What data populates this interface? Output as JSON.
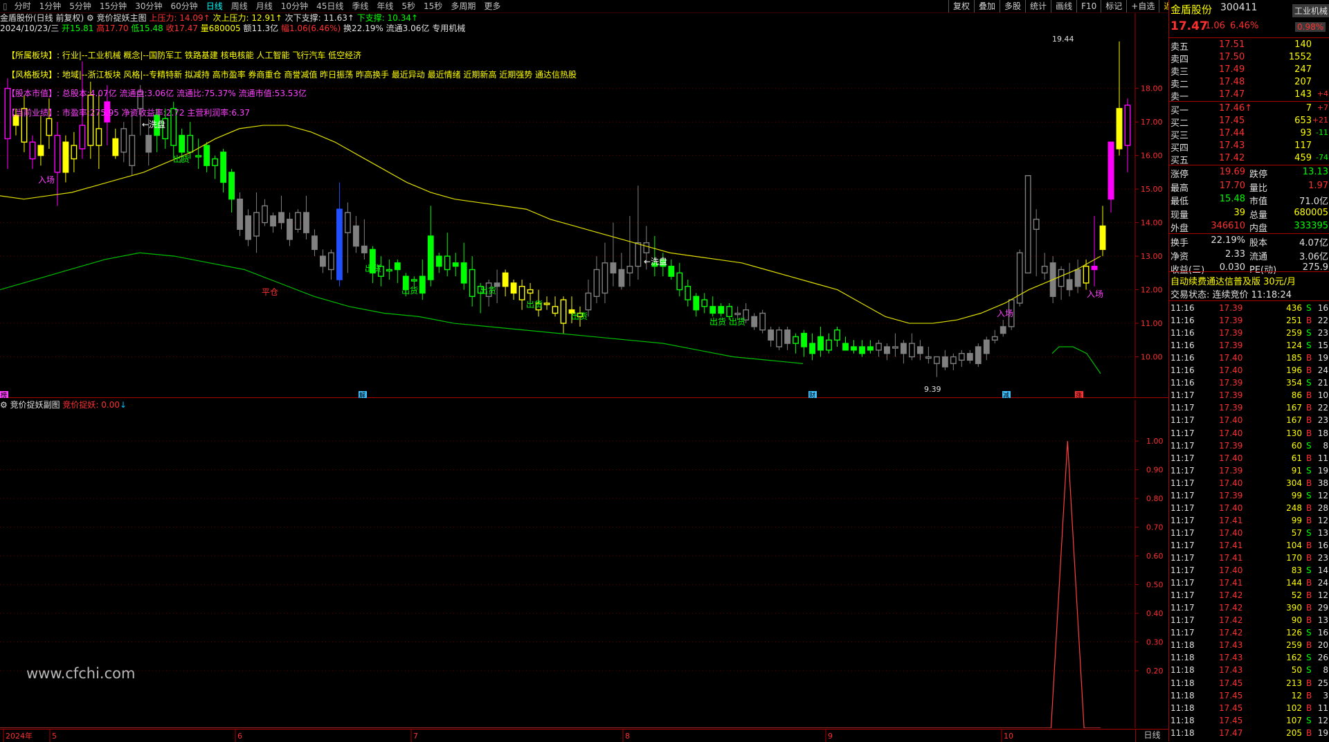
{
  "toolbar": {
    "tabs": [
      "分时",
      "1分钟",
      "5分钟",
      "15分钟",
      "30分钟",
      "60分钟",
      "日线",
      "周线",
      "月线",
      "10分钟",
      "45日线",
      "季线",
      "年线",
      "5秒",
      "15秒",
      "多周期",
      "更多"
    ],
    "active_tab": "日线",
    "right_buttons": [
      "复权",
      "叠加",
      "多股",
      "统计",
      "画线",
      "F10",
      "标记",
      "+自选",
      "返回"
    ]
  },
  "header": {
    "stock_label": "金盾股份(日线 前复权)",
    "indicator_name": "竞价捉妖主图",
    "resist": "上压力: 14.09",
    "resist2": "次上压力: 12.91",
    "support2": "次下支撑: 11.63",
    "support": "下支撑: 10.34",
    "date": "2024/10/23/三",
    "open": "开15.81",
    "high": "高17.70",
    "low": "低15.48",
    "close": "收17.47",
    "volume": "量680005",
    "amount": "额11.3亿",
    "change": "幅1.06(6.46%)",
    "turnover": "换22.19%",
    "float": "流通3.06亿",
    "sector": "专用机械"
  },
  "info": {
    "sector_label": "【所属板块】:",
    "sector_text": "行业|--工业机械  概念|--国防军工  铁路基建  核电核能  人工智能  飞行汽车  低空经济",
    "style_label": "【风格板块】:",
    "style_text": "地域|--浙江板块  风格|--专精特新  拟减持  高市盈率  券商重仓  商誉减值  昨日振荡  昨高换手  最近异动  最近情绪  近期新高  近期强势  通达信热股",
    "cap_label": "【股本市值】:",
    "cap_text": "总股本:4.07亿  流通盘:3.06亿  流通比:75.37%  流通市值:53.53亿",
    "perf_label": "【当前业绩】:",
    "perf_text": "市盈率:275.95  净资收益率:2.72  主营利润率:6.37"
  },
  "chart_labels": {
    "xipan1": "←洗盘",
    "xipan2": "←洗盘",
    "ruchang": "入场",
    "chuhuo": "出货",
    "pingcang": "平仓",
    "max_label": "19.44",
    "min_label": "9.39"
  },
  "price_axis": [
    "18.00",
    "17.00",
    "16.00",
    "15.00",
    "14.00",
    "13.00",
    "12.00",
    "11.00",
    "10.00"
  ],
  "bottom_badges": [
    "榜",
    "解",
    "财",
    "减",
    "涨"
  ],
  "sub": {
    "title": "竞价捉妖副图",
    "value_label": "竞价捉妖: 0.00",
    "axis": [
      "1.00",
      "0.90",
      "0.80",
      "0.70",
      "0.60",
      "0.50",
      "0.40",
      "0.30",
      "0.20"
    ],
    "watermark": "www.cfchi.com"
  },
  "time_axis": {
    "labels": [
      "2024年",
      "5",
      "6",
      "7",
      "8",
      "9",
      "10"
    ],
    "period": "日线"
  },
  "quote": {
    "name": "金盾股份",
    "code": "300411",
    "industry_tag": "工业机械",
    "price": "17.47",
    "change": "1.06",
    "pct": "6.46%",
    "ratio": "0.98%",
    "asks": [
      {
        "label": "卖五",
        "price": "17.51",
        "vol": "140",
        "chg": ""
      },
      {
        "label": "卖四",
        "price": "17.50",
        "vol": "1552",
        "chg": ""
      },
      {
        "label": "卖三",
        "price": "17.49",
        "vol": "247",
        "chg": ""
      },
      {
        "label": "卖二",
        "price": "17.48",
        "vol": "207",
        "chg": ""
      },
      {
        "label": "卖一",
        "price": "17.47",
        "vol": "143",
        "chg": "+4"
      }
    ],
    "bids": [
      {
        "label": "买一",
        "price": "17.46↑",
        "vol": "7",
        "chg": "+7"
      },
      {
        "label": "买二",
        "price": "17.45",
        "vol": "653",
        "chg": "+21"
      },
      {
        "label": "买三",
        "price": "17.44",
        "vol": "93",
        "chg": "-11"
      },
      {
        "label": "买四",
        "price": "17.43",
        "vol": "117",
        "chg": ""
      },
      {
        "label": "买五",
        "price": "17.42",
        "vol": "459",
        "chg": "-74"
      }
    ],
    "stats": [
      {
        "l1": "涨停",
        "v1": "19.69",
        "l2": "跌停",
        "v2": "13.13"
      },
      {
        "l1": "最高",
        "v1": "17.70",
        "l2": "量比",
        "v2": "1.97"
      },
      {
        "l1": "最低",
        "v1": "15.48",
        "l2": "市值",
        "v2": "71.0亿"
      },
      {
        "l1": "现量",
        "v1": "39",
        "l2": "总量",
        "v2": "680005"
      },
      {
        "l1": "外盘",
        "v1": "346610",
        "l2": "内盘",
        "v2": "333395"
      }
    ],
    "stats2": [
      {
        "l1": "换手",
        "v1": "22.19%",
        "l2": "股本",
        "v2": "4.07亿"
      },
      {
        "l1": "净资",
        "v1": "2.33",
        "l2": "流通",
        "v2": "3.06亿"
      },
      {
        "l1": "收益(三)",
        "v1": "0.030",
        "l2": "PE(动)",
        "v2": "275.9"
      }
    ],
    "promo": "自动续费通达信普及版 30元/月",
    "status": "交易状态: 连续竞价 11:18:24"
  },
  "ticks": [
    {
      "t": "11:16",
      "p": "17.39",
      "v": "436",
      "s": "S",
      "n": "16"
    },
    {
      "t": "11:16",
      "p": "17.39",
      "v": "251",
      "s": "B",
      "n": "22"
    },
    {
      "t": "11:16",
      "p": "17.39",
      "v": "259",
      "s": "S",
      "n": "23"
    },
    {
      "t": "11:16",
      "p": "17.39",
      "v": "124",
      "s": "S",
      "n": "15"
    },
    {
      "t": "11:16",
      "p": "17.40",
      "v": "185",
      "s": "B",
      "n": "19"
    },
    {
      "t": "11:16",
      "p": "17.40",
      "v": "196",
      "s": "B",
      "n": "24"
    },
    {
      "t": "11:16",
      "p": "17.39",
      "v": "354",
      "s": "S",
      "n": "21"
    },
    {
      "t": "11:17",
      "p": "17.39",
      "v": "86",
      "s": "B",
      "n": "10"
    },
    {
      "t": "11:17",
      "p": "17.39",
      "v": "167",
      "s": "B",
      "n": "22"
    },
    {
      "t": "11:17",
      "p": "17.40",
      "v": "167",
      "s": "B",
      "n": "23"
    },
    {
      "t": "11:17",
      "p": "17.40",
      "v": "130",
      "s": "B",
      "n": "18"
    },
    {
      "t": "11:17",
      "p": "17.39",
      "v": "60",
      "s": "S",
      "n": "8"
    },
    {
      "t": "11:17",
      "p": "17.40",
      "v": "61",
      "s": "B",
      "n": "11"
    },
    {
      "t": "11:17",
      "p": "17.39",
      "v": "91",
      "s": "S",
      "n": "19"
    },
    {
      "t": "11:17",
      "p": "17.40",
      "v": "304",
      "s": "B",
      "n": "38"
    },
    {
      "t": "11:17",
      "p": "17.39",
      "v": "99",
      "s": "S",
      "n": "12"
    },
    {
      "t": "11:17",
      "p": "17.40",
      "v": "248",
      "s": "B",
      "n": "28"
    },
    {
      "t": "11:17",
      "p": "17.41",
      "v": "99",
      "s": "B",
      "n": "12"
    },
    {
      "t": "11:17",
      "p": "17.40",
      "v": "57",
      "s": "S",
      "n": "13"
    },
    {
      "t": "11:17",
      "p": "17.41",
      "v": "104",
      "s": "B",
      "n": "16"
    },
    {
      "t": "11:17",
      "p": "17.41",
      "v": "170",
      "s": "B",
      "n": "23"
    },
    {
      "t": "11:17",
      "p": "17.40",
      "v": "83",
      "s": "S",
      "n": "14"
    },
    {
      "t": "11:17",
      "p": "17.41",
      "v": "144",
      "s": "B",
      "n": "24"
    },
    {
      "t": "11:17",
      "p": "17.42",
      "v": "52",
      "s": "B",
      "n": "12"
    },
    {
      "t": "11:17",
      "p": "17.42",
      "v": "390",
      "s": "B",
      "n": "29"
    },
    {
      "t": "11:17",
      "p": "17.42",
      "v": "90",
      "s": "B",
      "n": "13"
    },
    {
      "t": "11:17",
      "p": "17.42",
      "v": "126",
      "s": "S",
      "n": "16"
    },
    {
      "t": "11:18",
      "p": "17.43",
      "v": "259",
      "s": "B",
      "n": "20"
    },
    {
      "t": "11:18",
      "p": "17.43",
      "v": "162",
      "s": "S",
      "n": "26"
    },
    {
      "t": "11:18",
      "p": "17.43",
      "v": "50",
      "s": "S",
      "n": "8"
    },
    {
      "t": "11:18",
      "p": "17.45",
      "v": "213",
      "s": "B",
      "n": "25"
    },
    {
      "t": "11:18",
      "p": "17.45",
      "v": "12",
      "s": "B",
      "n": "3"
    },
    {
      "t": "11:18",
      "p": "17.45",
      "v": "102",
      "s": "B",
      "n": "11"
    },
    {
      "t": "11:18",
      "p": "17.45",
      "v": "107",
      "s": "S",
      "n": "12"
    },
    {
      "t": "11:18",
      "p": "17.47",
      "v": "205",
      "s": "B",
      "n": "19"
    }
  ],
  "chart_data": {
    "type": "candlestick",
    "dates": [
      "5月",
      "6月",
      "7月",
      "8月",
      "9月",
      "10月"
    ],
    "candles": [
      [
        16.5,
        18.0,
        15.6,
        18.3
      ],
      [
        17.2,
        16.9,
        16.6,
        17.4
      ],
      [
        16.4,
        17.4,
        16.1,
        17.8
      ],
      [
        15.9,
        16.4,
        15.6,
        16.6
      ],
      [
        16.3,
        16.0,
        15.7,
        17.2
      ],
      [
        16.6,
        17.1,
        16.2,
        17.7
      ],
      [
        15.5,
        16.6,
        14.5,
        17.0
      ],
      [
        16.4,
        15.5,
        15.2,
        16.6
      ],
      [
        15.9,
        16.3,
        15.5,
        16.7
      ],
      [
        16.2,
        16.9,
        15.9,
        18.8
      ],
      [
        16.3,
        17.8,
        15.9,
        18.2
      ],
      [
        16.3,
        16.8,
        15.6,
        17.8
      ],
      [
        17.6,
        17.0,
        16.3,
        18.1
      ],
      [
        16.5,
        16.0,
        15.9,
        16.8
      ],
      [
        16.1,
        16.8,
        15.8,
        17.0
      ],
      [
        15.7,
        16.6,
        15.4,
        17.3
      ],
      [
        17.4,
        17.9,
        16.6,
        18.1
      ],
      [
        16.6,
        16.1,
        15.7,
        17.1
      ],
      [
        17.2,
        16.6,
        16.1,
        17.4
      ],
      [
        16.5,
        17.1,
        16.2,
        17.4
      ],
      [
        16.3,
        17.4,
        15.9,
        17.6
      ],
      [
        16.6,
        16.1,
        15.8,
        16.8
      ],
      [
        16.1,
        16.6,
        15.9,
        17.0
      ],
      [
        16.0,
        16.0,
        15.6,
        16.5
      ],
      [
        16.3,
        15.7,
        15.5,
        16.4
      ],
      [
        15.7,
        15.9,
        15.3,
        16.0
      ],
      [
        16.1,
        15.2,
        14.9,
        16.2
      ],
      [
        15.5,
        14.7,
        14.3,
        15.6
      ],
      [
        14.7,
        13.8,
        13.6,
        14.9
      ],
      [
        14.2,
        13.5,
        13.3,
        14.4
      ],
      [
        13.6,
        14.3,
        13.1,
        14.9
      ],
      [
        14.0,
        14.5,
        13.9,
        14.7
      ],
      [
        14.2,
        13.9,
        13.7,
        14.3
      ],
      [
        14.3,
        14.0,
        13.8,
        14.8
      ],
      [
        14.1,
        13.5,
        13.3,
        14.3
      ],
      [
        13.8,
        14.3,
        13.7,
        14.4
      ],
      [
        14.3,
        13.7,
        13.5,
        14.8
      ],
      [
        13.6,
        13.2,
        13.0,
        13.8
      ],
      [
        13.0,
        12.7,
        12.5,
        13.2
      ],
      [
        12.6,
        13.1,
        12.3,
        13.2
      ],
      [
        14.4,
        12.3,
        12.1,
        15.2
      ],
      [
        13.7,
        14.3,
        12.5,
        14.6
      ],
      [
        13.9,
        13.3,
        13.1,
        14.2
      ],
      [
        13.3,
        13.1,
        12.9,
        14.1
      ],
      [
        13.2,
        12.5,
        12.2,
        13.3
      ],
      [
        12.4,
        12.7,
        12.1,
        13.0
      ],
      [
        12.6,
        12.6,
        12.3,
        12.9
      ],
      [
        12.8,
        12.6,
        12.2,
        12.9
      ],
      [
        12.4,
        12.0,
        11.8,
        12.5
      ],
      [
        12.3,
        12.3,
        12.1,
        12.4
      ],
      [
        12.4,
        11.9,
        11.7,
        12.9
      ],
      [
        13.6,
        12.3,
        12.1,
        14.5
      ],
      [
        13.0,
        12.7,
        12.5,
        13.1
      ],
      [
        12.6,
        13.0,
        12.4,
        13.7
      ],
      [
        12.8,
        12.7,
        12.4,
        13.1
      ],
      [
        12.8,
        12.2,
        12.0,
        13.4
      ],
      [
        11.8,
        12.6,
        11.5,
        13.0
      ],
      [
        11.9,
        12.1,
        11.3,
        12.2
      ],
      [
        11.8,
        12.2,
        11.5,
        12.3
      ],
      [
        12.2,
        12.1,
        11.6,
        12.6
      ],
      [
        12.5,
        12.1,
        11.8,
        12.6
      ],
      [
        12.2,
        11.9,
        11.7,
        12.3
      ],
      [
        11.7,
        12.1,
        11.4,
        12.3
      ],
      [
        11.9,
        12.0,
        11.6,
        12.2
      ],
      [
        11.4,
        11.6,
        11.2,
        12.0
      ],
      [
        11.6,
        11.6,
        11.4,
        11.8
      ],
      [
        11.3,
        11.5,
        11.2,
        11.8
      ],
      [
        11.0,
        11.7,
        10.7,
        11.8
      ],
      [
        11.4,
        11.3,
        11.0,
        11.8
      ],
      [
        11.2,
        11.3,
        10.9,
        11.5
      ],
      [
        11.4,
        11.9,
        11.2,
        12.3
      ],
      [
        11.8,
        12.6,
        11.6,
        13.0
      ],
      [
        11.9,
        12.8,
        11.6,
        13.4
      ],
      [
        12.8,
        12.5,
        12.1,
        14.0
      ],
      [
        12.6,
        12.1,
        12.0,
        13.1
      ],
      [
        12.5,
        12.7,
        12.1,
        14.2
      ],
      [
        12.7,
        13.4,
        12.3,
        15.1
      ],
      [
        13.1,
        13.4,
        12.6,
        13.9
      ],
      [
        12.8,
        12.7,
        12.4,
        13.6
      ],
      [
        12.9,
        12.7,
        12.4,
        13.1
      ],
      [
        12.7,
        12.4,
        12.3,
        12.9
      ],
      [
        12.0,
        12.5,
        11.8,
        12.8
      ],
      [
        11.7,
        12.1,
        11.5,
        12.3
      ],
      [
        11.8,
        11.4,
        11.2,
        11.9
      ],
      [
        11.5,
        11.7,
        11.3,
        11.9
      ],
      [
        11.5,
        11.3,
        11.2,
        11.8
      ],
      [
        11.5,
        11.3,
        11.2,
        11.6
      ],
      [
        11.2,
        11.5,
        11.1,
        11.6
      ],
      [
        11.3,
        11.3,
        11.1,
        11.5
      ],
      [
        11.1,
        11.4,
        11.0,
        11.6
      ],
      [
        11.2,
        10.9,
        10.8,
        11.3
      ],
      [
        10.8,
        11.3,
        10.7,
        11.4
      ],
      [
        10.8,
        10.5,
        10.3,
        10.9
      ],
      [
        10.3,
        10.8,
        10.2,
        10.9
      ],
      [
        10.8,
        10.4,
        10.2,
        10.9
      ],
      [
        10.4,
        10.6,
        10.1,
        10.7
      ],
      [
        10.7,
        10.3,
        10.0,
        10.8
      ],
      [
        10.4,
        10.1,
        9.9,
        10.7
      ],
      [
        10.6,
        10.2,
        10.0,
        10.9
      ],
      [
        10.2,
        10.5,
        10.1,
        10.7
      ],
      [
        10.5,
        10.8,
        10.3,
        10.9
      ],
      [
        10.4,
        10.2,
        10.2,
        10.6
      ],
      [
        10.3,
        10.2,
        10.1,
        10.5
      ],
      [
        10.3,
        10.1,
        10.0,
        10.5
      ],
      [
        10.3,
        10.2,
        10.1,
        10.5
      ],
      [
        10.2,
        10.4,
        10.0,
        10.5
      ],
      [
        10.3,
        10.1,
        9.9,
        10.4
      ],
      [
        10.3,
        10.3,
        10.0,
        10.7
      ],
      [
        10.4,
        10.1,
        9.8,
        10.5
      ],
      [
        10.0,
        10.4,
        9.9,
        10.7
      ],
      [
        10.3,
        10.1,
        9.9,
        10.5
      ],
      [
        10.0,
        10.0,
        9.8,
        10.3
      ],
      [
        9.8,
        10.0,
        9.4,
        10.0
      ],
      [
        10.0,
        9.7,
        9.6,
        10.2
      ],
      [
        9.8,
        10.0,
        9.6,
        10.1
      ],
      [
        9.9,
        10.1,
        9.7,
        10.2
      ],
      [
        10.1,
        9.9,
        9.8,
        10.2
      ],
      [
        10.3,
        9.8,
        9.7,
        10.4
      ],
      [
        10.5,
        10.1,
        9.9,
        10.6
      ],
      [
        10.5,
        10.6,
        10.4,
        10.8
      ],
      [
        10.9,
        10.7,
        10.6,
        11.1
      ],
      [
        10.9,
        11.7,
        10.8,
        11.7
      ],
      [
        11.6,
        13.1,
        11.5,
        13.2
      ],
      [
        12.5,
        15.4,
        12.5,
        15.4
      ],
      [
        13.8,
        14.1,
        12.4,
        14.4
      ],
      [
        12.5,
        12.7,
        12.3,
        13.1
      ],
      [
        12.8,
        11.8,
        11.6,
        13.0
      ],
      [
        12.1,
        12.6,
        11.7,
        12.7
      ],
      [
        12.3,
        12.0,
        11.8,
        12.8
      ],
      [
        12.6,
        12.1,
        11.9,
        12.9
      ],
      [
        12.2,
        12.7,
        12.0,
        12.9
      ],
      [
        12.7,
        12.6,
        12.1,
        14.2
      ],
      [
        13.9,
        13.2,
        13.0,
        14.5
      ],
      [
        16.4,
        14.7,
        14.3,
        16.4
      ],
      [
        17.4,
        16.2,
        16.0,
        19.4
      ],
      [
        16.3,
        17.5,
        15.5,
        17.7
      ]
    ],
    "line_yellow": [
      14.8,
      14.7,
      14.8,
      14.9,
      15.1,
      15.3,
      15.5,
      15.8,
      16.1,
      16.5,
      16.8,
      16.9,
      16.9,
      16.7,
      16.4,
      16.0,
      15.6,
      15.2,
      14.9,
      14.7,
      14.6,
      14.5,
      14.4,
      14.1,
      13.9,
      13.7,
      13.5,
      13.3,
      13.1,
      13.0,
      12.9,
      12.8,
      12.6,
      12.4,
      12.2,
      12.0,
      11.6,
      11.2,
      11.0,
      11.0,
      11.1,
      11.3,
      11.6,
      12.0,
      12.3,
      12.6,
      13.0
    ],
    "line_green": [
      12.0,
      12.3,
      12.6,
      12.9,
      13.1,
      13.0,
      12.8,
      12.6,
      12.2,
      11.8,
      11.5,
      11.3,
      11.2,
      11.0,
      10.9,
      10.8,
      10.7,
      10.6,
      10.5,
      10.4,
      10.2,
      10.0,
      9.9,
      9.8,
      10.1,
      10.3,
      10.3,
      10.3,
      10.2,
      10.1,
      9.8,
      9.5
    ],
    "sub_series": {
      "name": "竞价捉妖",
      "x_ratio": [
        0.0,
        0.955,
        0.97,
        0.985,
        1.0
      ],
      "values": [
        0,
        0,
        1,
        0,
        0
      ]
    },
    "ylim": [
      9.0,
      19.5
    ],
    "colors": {
      "yellow": "#ffff00",
      "magenta": "#ff00ff",
      "green": "#00ff00",
      "gray": "#808080",
      "blue": "#2050ff"
    }
  }
}
